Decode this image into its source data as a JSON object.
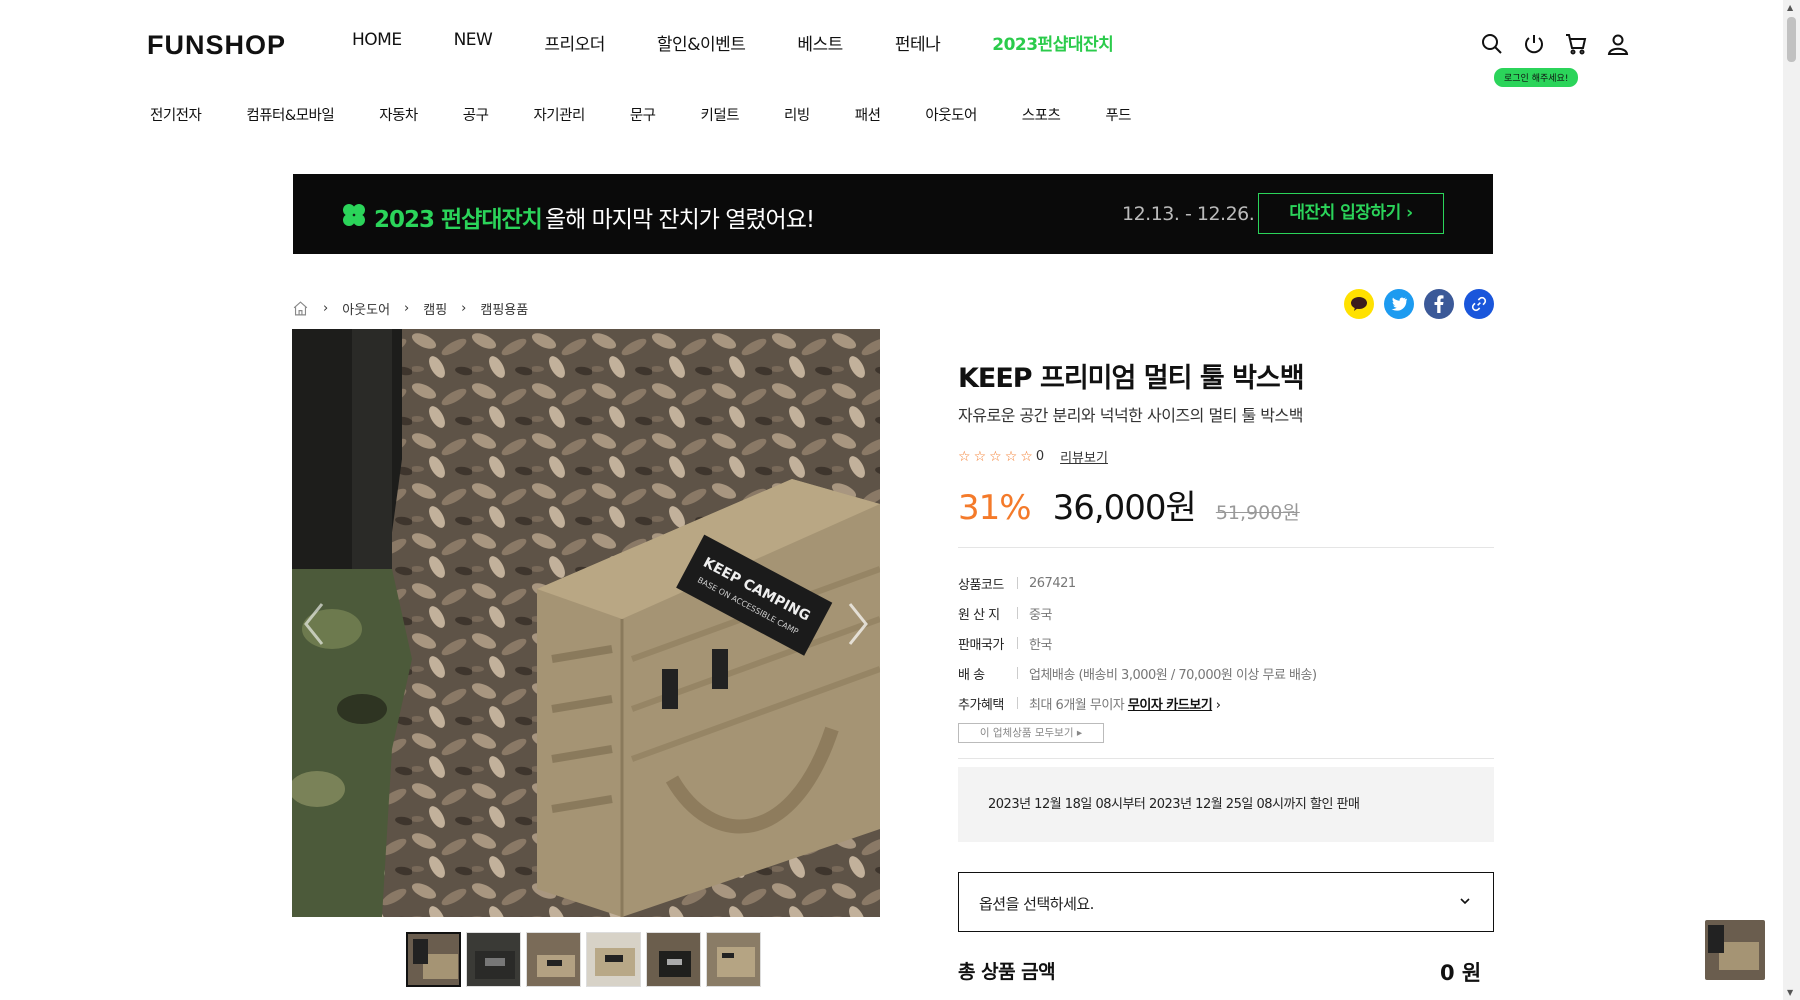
{
  "header": {
    "logo": "FUNSHOP",
    "nav": [
      "HOME",
      "NEW",
      "프리오더",
      "할인&이벤트",
      "베스트",
      "펀테나",
      "2023펀샵대잔치"
    ],
    "login_badge": "로그인 해주세요!",
    "icons": [
      "search-icon",
      "power-icon",
      "cart-icon",
      "user-icon"
    ]
  },
  "categories": [
    "전기전자",
    "컴퓨터&모바일",
    "자동차",
    "공구",
    "자기관리",
    "문구",
    "키덜트",
    "리빙",
    "패션",
    "아웃도어",
    "스포츠",
    "푸드"
  ],
  "banner": {
    "title": "2023 펀샵대잔치",
    "subtitle": "올해 마지막 잔치가 열렸어요!",
    "date": "12.13. - 12.26.",
    "button": "대잔치 입장하기 ›"
  },
  "breadcrumb": [
    "아웃도어",
    "캠핑",
    "캠핑용품"
  ],
  "share": [
    "kakaotalk-icon",
    "twitter-icon",
    "facebook-icon",
    "link-icon"
  ],
  "product": {
    "title": "KEEP 프리미엄 멀티 툴 박스백",
    "desc": "자유로운 공간 분리와 넉넉한 사이즈의 멀티 툴 박스백",
    "rating_count": "0",
    "review_link": "리뷰보기",
    "discount": "31%",
    "price": "36,000원",
    "original_price": "51,900원",
    "specs": [
      {
        "key": "상품코드",
        "value": "267421"
      },
      {
        "key": "원 산 지",
        "value": "중국"
      },
      {
        "key": "판매국가",
        "value": "한국"
      },
      {
        "key": "배 송",
        "value": "업체배송 (배송비 3,000원 / 70,000원 이상 무료 배송)"
      },
      {
        "key": "추가혜택",
        "value": "최대 6개월 무이자",
        "link": "무이자 카드보기"
      }
    ],
    "all_products_button": "이 업체상품 모두보기 ▸",
    "notice": "2023년 12월 18일 08시부터 2023년 12월 25일 08시까지 할인 판매",
    "option_placeholder": "옵션을 선택하세요.",
    "total_label": "총 상품 금액",
    "total_value": "0 원",
    "image_label_line1": "KEEP CAMPING",
    "image_label_line2": "BASE ON ACCESSIBLE CAMP"
  },
  "colors": {
    "accent_green": "#2bd45a",
    "discount_orange": "#f47a2a",
    "banner_bg": "#0a0a0a"
  }
}
